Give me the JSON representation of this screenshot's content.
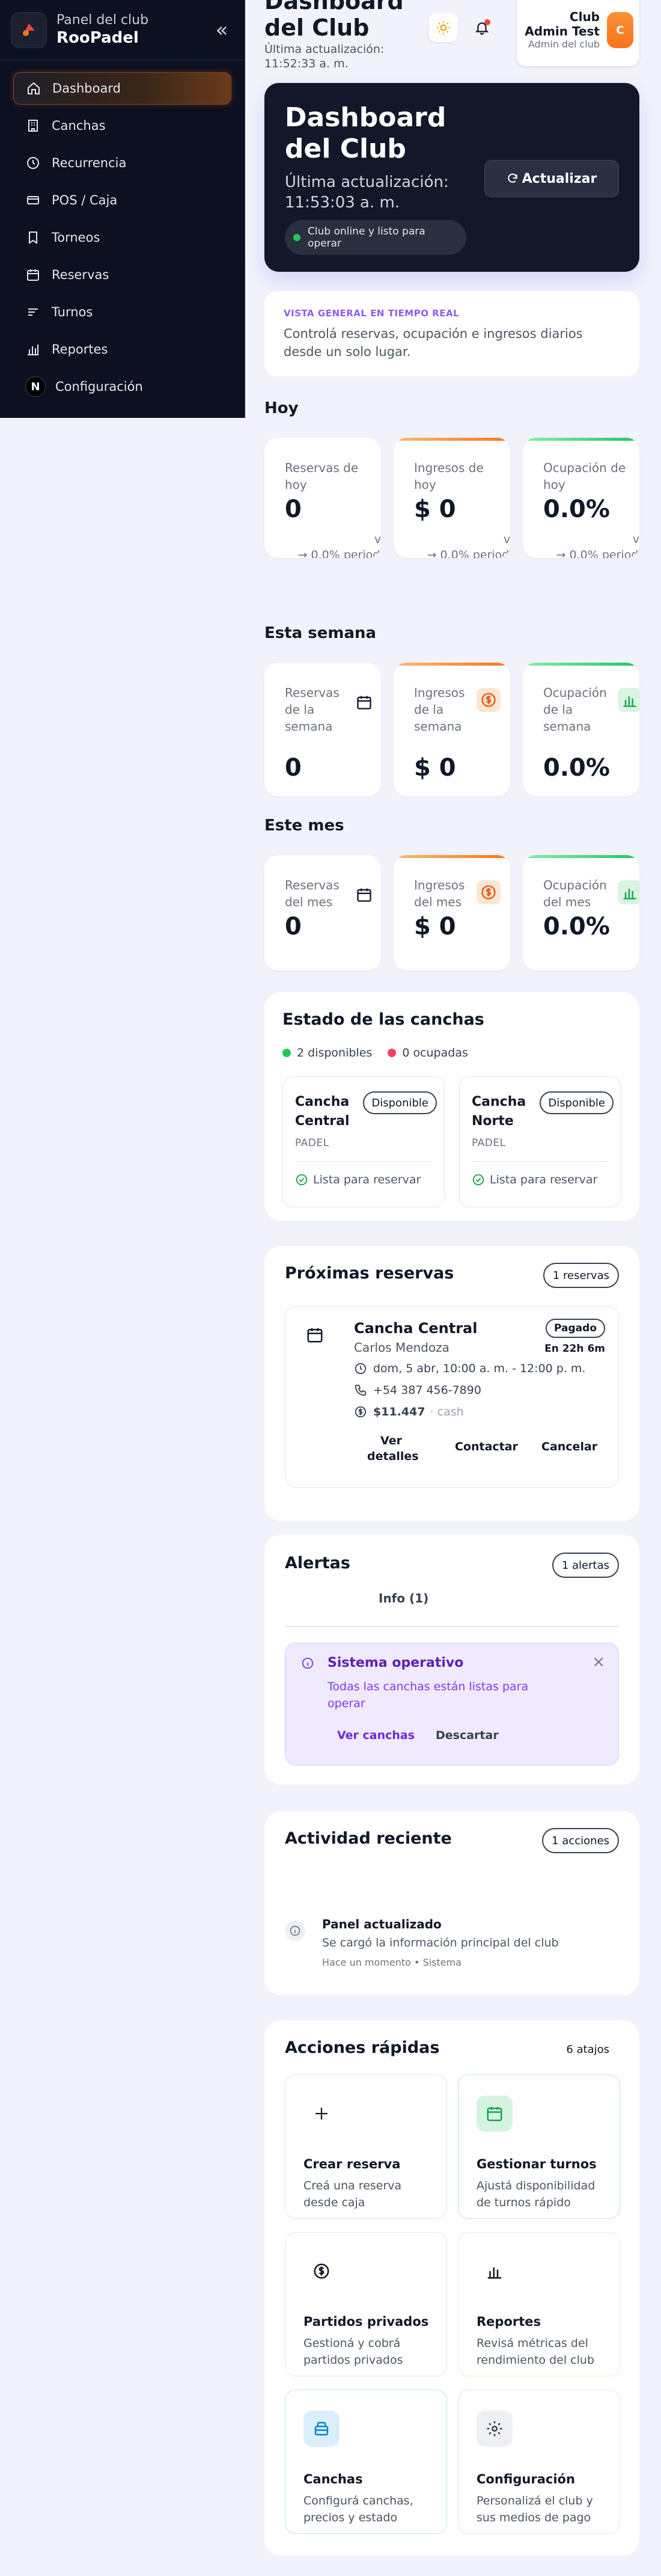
{
  "sidebar": {
    "subtitle": "Panel del club",
    "title": "RooPadel",
    "items": [
      {
        "label": "Dashboard",
        "icon": "home-icon",
        "active": true
      },
      {
        "label": "Canchas",
        "icon": "building-icon"
      },
      {
        "label": "Recurrencia",
        "icon": "clock-icon"
      },
      {
        "label": "POS / Caja",
        "icon": "credit-card-icon"
      },
      {
        "label": "Torneos",
        "icon": "bookmark-icon"
      },
      {
        "label": "Reservas",
        "icon": "calendar-icon"
      },
      {
        "label": "Turnos",
        "icon": "list-icon"
      },
      {
        "label": "Reportes",
        "icon": "bar-chart-icon"
      },
      {
        "label": "Configuración",
        "icon": "n-badge-icon"
      }
    ],
    "n_badge": "N"
  },
  "topbar": {
    "title": "Dashboard del Club",
    "last_update": "Última actualización: 11:52:33 a. m.",
    "user_name": "Club Admin Test",
    "user_role": "Admin del club",
    "avatar_letter": "C"
  },
  "hero": {
    "title": "Dashboard del Club",
    "last_update": "Última actualización: 11:53:03 a. m.",
    "status": "Club online y listo para operar",
    "button": "Actualizar"
  },
  "overview": {
    "kicker": "VISTA GENERAL EN TIEMPO REAL",
    "text": "Controlá reservas, ocupación e ingresos diarios desde un solo lugar."
  },
  "today": {
    "title": "Hoy",
    "cards": [
      {
        "label": "Reservas de hoy",
        "value": "0",
        "compare_vs": "vs",
        "compare_pct": "→ 0.0%",
        "compare_text": "periodo anterior"
      },
      {
        "label": "Ingresos de hoy",
        "value": "$ 0",
        "compare_vs": "vs",
        "compare_pct": "→ 0.0%",
        "compare_text": "periodo anterior"
      },
      {
        "label": "Ocupación de hoy",
        "value": "0.0%",
        "compare_vs": "vs",
        "compare_pct": "→ 0.0%",
        "compare_text": "periodo anterior"
      }
    ]
  },
  "week": {
    "title": "Esta semana",
    "cards": [
      {
        "label": "Reservas de la semana",
        "value": "0"
      },
      {
        "label": "Ingresos de la semana",
        "value": "$ 0"
      },
      {
        "label": "Ocupación de la semana",
        "value": "0.0%"
      }
    ]
  },
  "month": {
    "title": "Este mes",
    "cards": [
      {
        "label": "Reservas del mes",
        "value": "0"
      },
      {
        "label": "Ingresos del mes",
        "value": "$ 0"
      },
      {
        "label": "Ocupación del mes",
        "value": "0.0%"
      }
    ]
  },
  "courts": {
    "title": "Estado de las canchas",
    "available": "2 disponibles",
    "occupied": "0 ocupadas",
    "items": [
      {
        "name": "Cancha Central",
        "badge": "Disponible",
        "type": "PADEL",
        "ready": "Lista para reservar"
      },
      {
        "name": "Cancha Norte",
        "badge": "Disponible",
        "type": "PADEL",
        "ready": "Lista para reservar"
      }
    ]
  },
  "upcoming": {
    "title": "Próximas reservas",
    "count": "1 reservas",
    "booking": {
      "court": "Cancha Central",
      "customer": "Carlos Mendoza",
      "status": "Pagado",
      "eta": "En 22h 6m",
      "datetime": "dom, 5 abr, 10:00 a. m. - 12:00 p. m.",
      "phone": "+54 387 456-7890",
      "amount": "$11.447",
      "method": "· cash",
      "actions": [
        "Ver detalles",
        "Contactar",
        "Cancelar"
      ]
    }
  },
  "alerts": {
    "title": "Alertas",
    "count": "1 alertas",
    "tab": "Info (1)",
    "alert_title": "Sistema operativo",
    "alert_text": "Todas las canchas están listas para operar",
    "view": "Ver canchas",
    "dismiss": "Descartar"
  },
  "activity": {
    "title": "Actividad reciente",
    "count": "1 acciones",
    "item_title": "Panel actualizado",
    "item_text": "Se cargó la información principal del club",
    "item_time": "Hace un momento",
    "item_source": "Sistema"
  },
  "quick": {
    "title": "Acciones rápidas",
    "count": "6 atajos",
    "items": [
      {
        "title": "Crear reserva",
        "desc": "Creá una reserva desde caja",
        "icon": "plus-icon"
      },
      {
        "title": "Gestionar turnos",
        "desc": "Ajustá disponibilidad de turnos rápido",
        "icon": "calendar-icon"
      },
      {
        "title": "Partidos privados",
        "desc": "Gestioná y cobrá partidos privados",
        "icon": "dollar-icon"
      },
      {
        "title": "Reportes",
        "desc": "Revisá métricas del rendimiento del club",
        "icon": "bar-chart-icon"
      },
      {
        "title": "Canchas",
        "desc": "Configurá canchas, precios y estado",
        "icon": "court-icon"
      },
      {
        "title": "Configuración",
        "desc": "Personalizá el club y sus medios de pago",
        "icon": "gear-icon"
      }
    ]
  },
  "colors": {
    "accent": "#f97316",
    "success": "#22c55e",
    "danger": "#ef4444",
    "purple": "#8b5cf6"
  }
}
